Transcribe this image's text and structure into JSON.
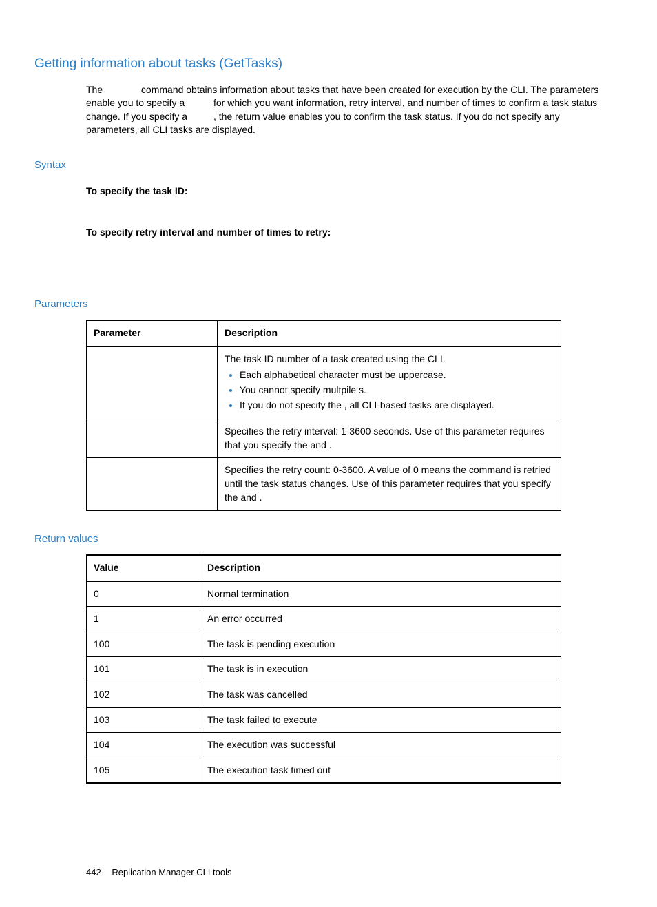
{
  "heading": "Getting information about tasks (GetTasks)",
  "intro": {
    "p1a": "The ",
    "p1b": " command obtains information about tasks that have been created for execution by the CLI. The parameters enable you to specify a ",
    "p1c": " for which you want information, retry interval, and number of times to confirm a task status change. If you specify a ",
    "p1d": ", the return value enables you to confirm the task status. If you do not specify any parameters, all CLI tasks are displayed."
  },
  "syntax": {
    "heading": "Syntax",
    "label1": "To specify the task ID:",
    "label2": "To specify retry interval and number of times to retry:"
  },
  "parameters": {
    "heading": "Parameters",
    "col1": "Parameter",
    "col2": "Description",
    "rows": [
      {
        "param": "",
        "desc_intro": "The task ID number of a task created using the CLI.",
        "bullets": [
          "Each alphabetical character must be uppercase.",
          "You cannot specify multpile            s.",
          "If you do not specify the             , all CLI-based tasks are displayed."
        ]
      },
      {
        "param": "",
        "desc": "Specifies the retry interval: 1-3600 seconds. Use of this parameter requires that you specify the              and                  ."
      },
      {
        "param": "",
        "desc": "Specifies the retry count: 0-3600. A value of 0 means the                   command is retried until the task status changes. Use of this parameter requires that you specify the              and                      ."
      }
    ]
  },
  "return_values": {
    "heading": "Return values",
    "col1": "Value",
    "col2": "Description",
    "rows": [
      {
        "v": "0",
        "d": "Normal termination"
      },
      {
        "v": "1",
        "d": "An error occurred"
      },
      {
        "v": "100",
        "d": "The task is pending execution"
      },
      {
        "v": "101",
        "d": "The task is in execution"
      },
      {
        "v": "102",
        "d": "The task was cancelled"
      },
      {
        "v": "103",
        "d": "The task failed to execute"
      },
      {
        "v": "104",
        "d": "The execution was successful"
      },
      {
        "v": "105",
        "d": "The execution task timed out"
      }
    ]
  },
  "footer": {
    "page": "442",
    "title": "Replication Manager CLI tools"
  }
}
